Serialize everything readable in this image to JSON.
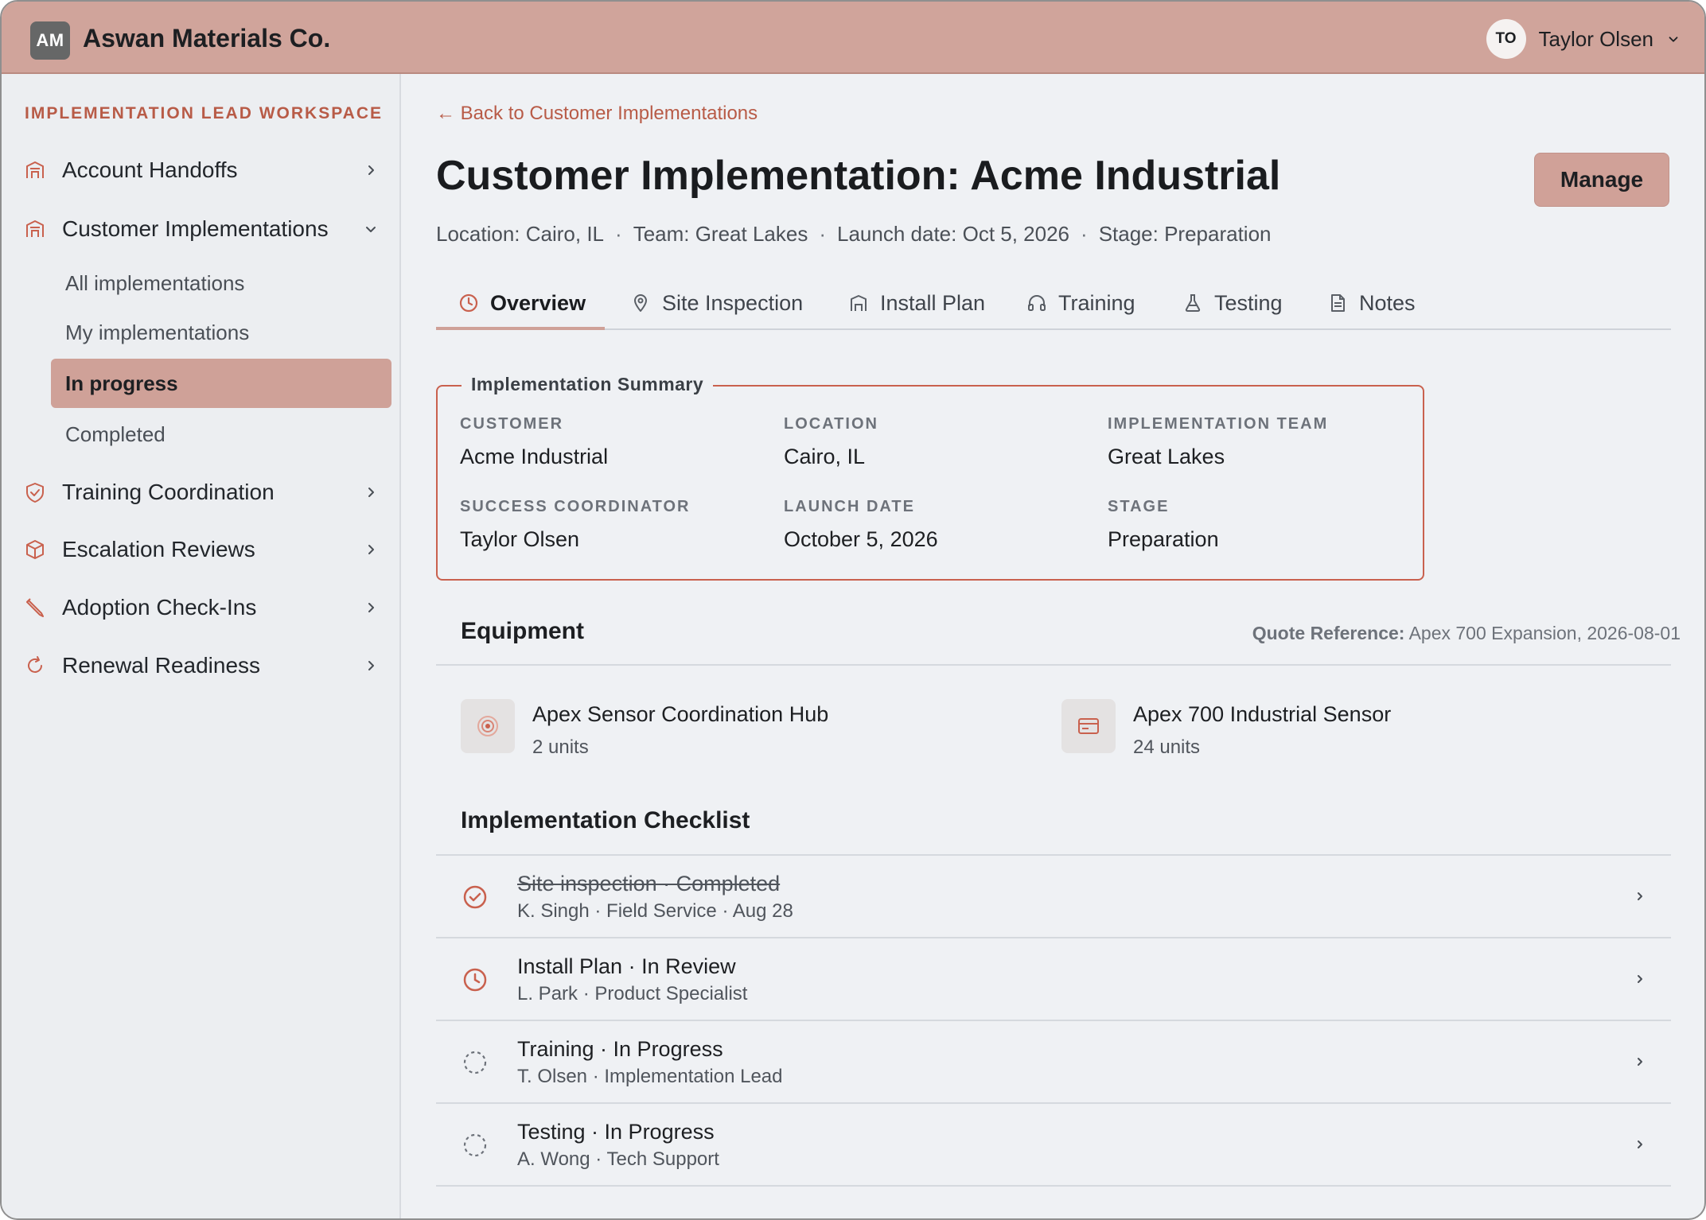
{
  "header": {
    "logo_initials": "AM",
    "company": "Aswan Materials Co.",
    "user_initials": "TO",
    "user_name": "Taylor Olsen"
  },
  "sidebar": {
    "workspace_label": "IMPLEMENTATION LEAD WORKSPACE",
    "items": [
      {
        "label": "Account Handoffs",
        "icon": "building-icon"
      },
      {
        "label": "Customer Implementations",
        "icon": "building-icon",
        "expanded": true
      },
      {
        "label": "Training Coordination",
        "icon": "shield-check-icon"
      },
      {
        "label": "Escalation Reviews",
        "icon": "box-icon"
      },
      {
        "label": "Adoption Check-Ins",
        "icon": "pen-icon"
      },
      {
        "label": "Renewal Readiness",
        "icon": "refresh-icon"
      }
    ],
    "sub_items": [
      {
        "label": "All implementations"
      },
      {
        "label": "My implementations"
      },
      {
        "label": "In progress",
        "active": true
      },
      {
        "label": "Completed"
      }
    ]
  },
  "main": {
    "back_link": "← Back to Customer Implementations",
    "title": "Customer Implementation: Acme Industrial",
    "manage_label": "Manage",
    "meta": {
      "location": "Location: Cairo, IL",
      "team": "Team: Great Lakes",
      "launch": "Launch date: Oct 5, 2026",
      "stage": "Stage: Preparation",
      "separator": "·"
    },
    "tabs": [
      {
        "label": "Overview",
        "icon": "clock-icon",
        "active": true
      },
      {
        "label": "Site Inspection",
        "icon": "map-pin-icon"
      },
      {
        "label": "Install Plan",
        "icon": "building-icon"
      },
      {
        "label": "Training",
        "icon": "headphones-icon"
      },
      {
        "label": "Testing",
        "icon": "flask-icon"
      },
      {
        "label": "Notes",
        "icon": "document-icon"
      }
    ],
    "summary": {
      "legend": "Implementation Summary",
      "fields": [
        {
          "label": "CUSTOMER",
          "value": "Acme Industrial"
        },
        {
          "label": "LOCATION",
          "value": "Cairo, IL"
        },
        {
          "label": "IMPLEMENTATION TEAM",
          "value": "Great Lakes"
        },
        {
          "label": "SUCCESS COORDINATOR",
          "value": "Taylor Olsen"
        },
        {
          "label": "LAUNCH DATE",
          "value": "October 5, 2026"
        },
        {
          "label": "STAGE",
          "value": "Preparation"
        }
      ]
    },
    "equipment": {
      "title": "Equipment",
      "quote_label": "Quote Reference:",
      "quote_value": "Apex 700 Expansion, 2026-08-01",
      "items": [
        {
          "name": "Apex Sensor Coordination Hub",
          "units": "2 units",
          "icon": "target-icon"
        },
        {
          "name": "Apex 700 Industrial Sensor",
          "units": "24 units",
          "icon": "card-icon"
        }
      ]
    },
    "checklist": {
      "title": "Implementation Checklist",
      "items": [
        {
          "title": "Site inspection · Completed",
          "sub": "K. Singh · Field Service · Aug 28",
          "status": "completed",
          "icon": "check-circle-icon"
        },
        {
          "title": "Install Plan · In Review",
          "sub": "L. Park · Product Specialist",
          "status": "in-review",
          "icon": "clock-icon"
        },
        {
          "title": "Training · In Progress",
          "sub": "T. Olsen · Implementation Lead",
          "status": "in-progress",
          "icon": "dashed-circle-icon"
        },
        {
          "title": "Testing · In Progress",
          "sub": "A. Wong · Tech Support",
          "status": "in-progress",
          "icon": "dashed-circle-icon"
        }
      ]
    }
  },
  "colors": {
    "accent": "#d0a49b",
    "accent_text": "#b85b47",
    "summary_border": "#c9614e"
  }
}
